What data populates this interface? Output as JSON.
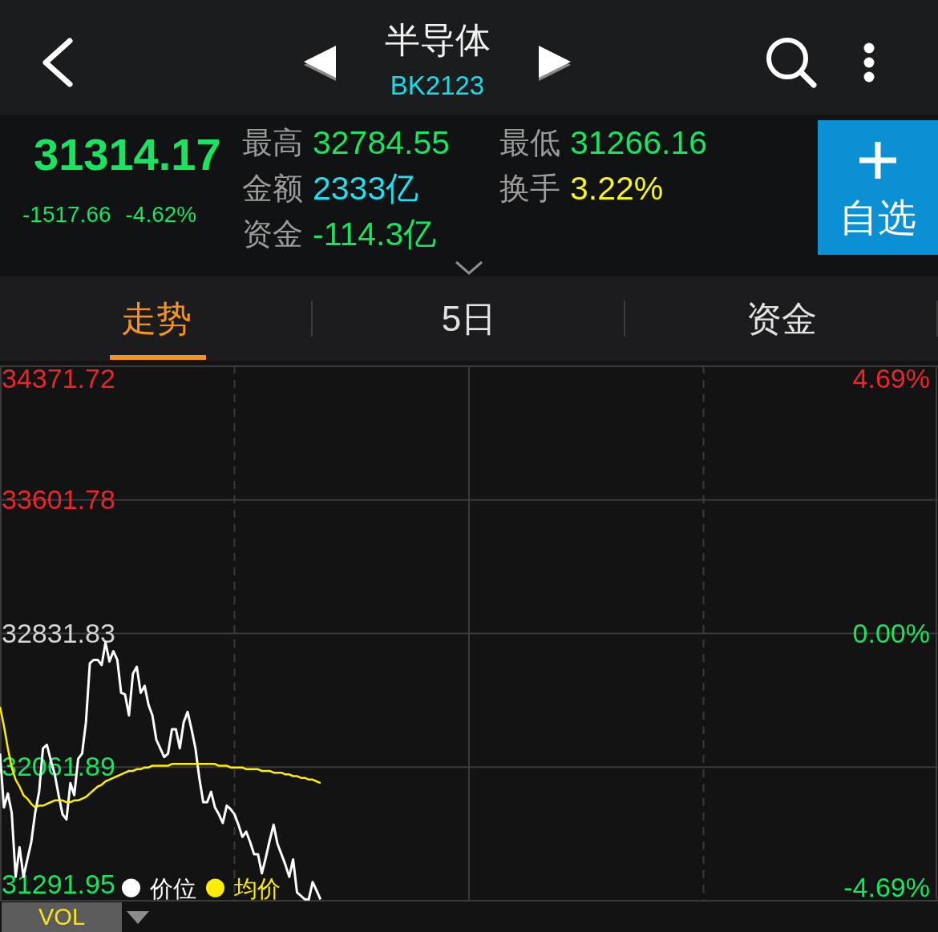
{
  "header": {
    "title": "半导体",
    "code": "BK2123"
  },
  "quote": {
    "price": "31314.17",
    "change": "-1517.66",
    "change_percent": "-4.62%",
    "falling": true,
    "stats": [
      {
        "label": "最高",
        "value": "32784.55",
        "color": "#1ae35f"
      },
      {
        "label": "最低",
        "value": "31266.16",
        "color": "#1ae35f"
      },
      {
        "label": "金额",
        "value": "2333亿",
        "color": "#21e0ee"
      },
      {
        "label": "换手",
        "value": "3.22%",
        "color": "#f5f51e"
      },
      {
        "label": "资金",
        "value": "-114.3亿",
        "color": "#1ae35f"
      }
    ],
    "watchlist_button": {
      "label": "自选"
    }
  },
  "tabs": [
    {
      "label": "走势",
      "selected": true
    },
    {
      "label": "5日",
      "selected": false
    },
    {
      "label": "资金",
      "selected": false
    }
  ],
  "chart": {
    "percent_labels": [
      {
        "text": "4.69%",
        "color": "#e8262b"
      },
      {
        "text": "0.00%",
        "color": "#1ae35f"
      },
      {
        "text": "-4.69%",
        "color": "#1ae35f"
      }
    ],
    "chart_data": {
      "type": "line",
      "grid": true,
      "legend": "lower left",
      "categories": [
        null,
        null,
        null,
        null,
        null,
        null,
        null,
        null,
        null,
        null,
        null,
        null,
        null,
        null,
        null,
        null,
        null,
        null,
        null,
        null,
        null,
        null,
        null,
        null,
        null,
        null,
        null,
        null,
        null,
        null,
        null,
        null,
        null,
        null,
        null,
        null,
        null,
        null,
        null,
        null,
        null,
        null,
        null,
        null,
        null,
        null,
        null,
        null,
        null,
        null,
        null,
        null,
        null,
        null,
        null,
        null,
        null,
        null,
        null,
        null,
        null,
        null,
        null,
        null,
        null,
        null,
        null,
        null,
        null,
        null,
        null,
        null,
        null,
        null,
        null,
        null,
        null,
        null,
        null,
        null,
        null,
        null,
        null,
        null,
        null,
        null,
        null,
        null,
        null,
        null,
        null,
        null,
        null,
        null,
        null,
        null,
        null,
        null,
        null,
        null,
        null,
        null,
        null,
        null,
        null,
        null,
        null,
        null,
        null,
        null,
        null,
        null,
        null,
        null,
        null,
        null,
        null,
        null,
        null,
        null,
        null,
        null,
        null,
        null,
        null,
        null,
        null,
        null,
        null,
        null,
        null,
        null,
        null,
        null,
        null,
        null,
        null,
        null,
        null,
        null,
        null,
        null,
        null,
        null,
        null,
        null,
        null,
        null,
        null,
        null,
        null,
        null,
        null,
        null,
        null,
        null,
        null,
        null,
        null,
        null,
        null,
        null,
        null,
        null,
        null,
        null,
        null,
        null,
        null,
        null,
        null,
        null,
        null,
        null,
        null,
        null,
        null,
        null,
        null,
        null,
        null,
        null,
        null,
        null,
        null,
        null,
        null,
        null,
        null,
        null,
        null,
        null,
        null,
        null,
        null,
        null,
        null,
        null,
        null,
        null,
        null,
        null,
        null,
        null,
        null,
        null,
        null,
        null,
        null,
        null,
        null,
        null,
        null,
        null,
        null,
        null,
        null,
        null,
        null,
        null,
        null,
        null,
        null,
        null,
        null,
        null,
        null,
        null,
        null,
        null,
        null,
        null,
        null,
        null,
        null,
        null,
        null,
        null,
        null,
        null,
        null
      ],
      "ylim": [
        31291.95,
        34371.72
      ],
      "yticks": [
        {
          "value": 31291.95,
          "label": "31291.95"
        },
        {
          "value": 32061.89,
          "label": "32061.89"
        },
        {
          "value": 32831.83,
          "label": "32831.83"
        },
        {
          "value": 33601.78,
          "label": "33601.78"
        },
        {
          "value": 34371.72,
          "label": "34371.72"
        }
      ],
      "series": [
        {
          "name": "价位",
          "color": "#ffffff",
          "values": [
            32140,
            31830,
            31910,
            31800,
            31430,
            31600,
            31430,
            31530,
            31630,
            31800,
            31920,
            32170,
            32190,
            32100,
            32020,
            31900,
            31790,
            31760,
            31970,
            31900,
            32110,
            32140,
            32320,
            32660,
            32680,
            32680,
            32650,
            32780,
            32670,
            32730,
            32680,
            32490,
            32480,
            32360,
            32600,
            32640,
            32490,
            32530,
            32420,
            32360,
            32220,
            32170,
            32120,
            32140,
            32280,
            32280,
            32170,
            32320,
            32380,
            32280,
            32170,
            32000,
            31860,
            31860,
            31920,
            31830,
            31790,
            31740,
            31840,
            31820,
            31790,
            31730,
            31660,
            31690,
            31630,
            31560,
            31560,
            31450,
            31540,
            31640,
            31730,
            31620,
            31560,
            31500,
            31430,
            31530,
            31340,
            31320,
            31300,
            31300,
            31400,
            31350,
            31300,
            null,
            null,
            null,
            null,
            null,
            null,
            null,
            null,
            null,
            null,
            null,
            null,
            null,
            null,
            null,
            null,
            null,
            null,
            null,
            null,
            null,
            null,
            null,
            null,
            null,
            null,
            null,
            null,
            null,
            null,
            null,
            null,
            null,
            null,
            null,
            null,
            null,
            null,
            null,
            null,
            null,
            null,
            null,
            null,
            null,
            null,
            null,
            null,
            null,
            null,
            null,
            null,
            null,
            null,
            null,
            null,
            null,
            null,
            null,
            null,
            null,
            null,
            null,
            null,
            null,
            null,
            null,
            null,
            null,
            null,
            null,
            null,
            null,
            null,
            null,
            null,
            null,
            null,
            null,
            null,
            null,
            null,
            null,
            null,
            null,
            null,
            null,
            null,
            null,
            null,
            null,
            null,
            null,
            null,
            null,
            null,
            null,
            null,
            null,
            null,
            null,
            null,
            null,
            null,
            null,
            null,
            null,
            null,
            null,
            null,
            null,
            null,
            null,
            null,
            null,
            null,
            null,
            null,
            null,
            null,
            null,
            null,
            null,
            null,
            null,
            null,
            null,
            null,
            null,
            null,
            null,
            null,
            null,
            null,
            null,
            null,
            null,
            null,
            null,
            null,
            null,
            null,
            null,
            null,
            null,
            null,
            null,
            null,
            null,
            null,
            null,
            null,
            null,
            null,
            null,
            null,
            null,
            null
          ]
        },
        {
          "name": "均价",
          "color": "#ffee00",
          "values": [
            32410,
            32300,
            32170,
            32060,
            31990,
            31950,
            31900,
            31880,
            31850,
            31830,
            31840,
            31840,
            31850,
            31860,
            31870,
            31870,
            31870,
            31860,
            31860,
            31870,
            31870,
            31880,
            31890,
            31910,
            31930,
            31950,
            31960,
            31980,
            31990,
            32000,
            32010,
            32020,
            32030,
            32040,
            32040,
            32050,
            32050,
            32060,
            32060,
            32070,
            32070,
            32070,
            32070,
            32070,
            32080,
            32080,
            32080,
            32080,
            32080,
            32080,
            32080,
            32080,
            32080,
            32080,
            32080,
            32080,
            32070,
            32070,
            32070,
            32060,
            32060,
            32060,
            32060,
            32050,
            32050,
            32050,
            32050,
            32040,
            32040,
            32040,
            32030,
            32030,
            32030,
            32020,
            32020,
            32010,
            32010,
            32000,
            32000,
            31990,
            31990,
            31980,
            31970,
            null,
            null,
            null,
            null,
            null,
            null,
            null,
            null,
            null,
            null,
            null,
            null,
            null,
            null,
            null,
            null,
            null,
            null,
            null,
            null,
            null,
            null,
            null,
            null,
            null,
            null,
            null,
            null,
            null,
            null,
            null,
            null,
            null,
            null,
            null,
            null,
            null,
            null,
            null,
            null,
            null,
            null,
            null,
            null,
            null,
            null,
            null,
            null,
            null,
            null,
            null,
            null,
            null,
            null,
            null,
            null,
            null,
            null,
            null,
            null,
            null,
            null,
            null,
            null,
            null,
            null,
            null,
            null,
            null,
            null,
            null,
            null,
            null,
            null,
            null,
            null,
            null,
            null,
            null,
            null,
            null,
            null,
            null,
            null,
            null,
            null,
            null,
            null,
            null,
            null,
            null,
            null,
            null,
            null,
            null,
            null,
            null,
            null,
            null,
            null,
            null,
            null,
            null,
            null,
            null,
            null,
            null,
            null,
            null,
            null,
            null,
            null,
            null,
            null,
            null,
            null,
            null,
            null,
            null,
            null,
            null,
            null,
            null,
            null,
            null,
            null,
            null,
            null,
            null,
            null,
            null,
            null,
            null,
            null,
            null,
            null,
            null,
            null,
            null,
            null,
            null,
            null,
            null,
            null,
            null,
            null,
            null,
            null,
            null,
            null,
            null,
            null,
            null,
            null,
            null,
            null,
            null,
            null
          ]
        }
      ]
    }
  },
  "indicator": {
    "label": "VOL"
  }
}
